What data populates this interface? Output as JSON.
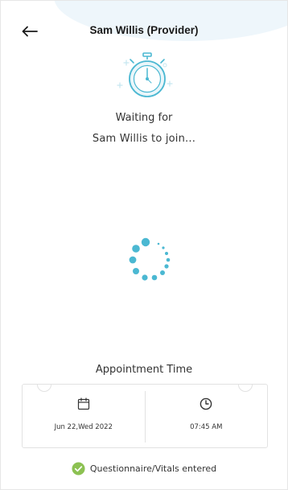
{
  "header": {
    "title": "Sam Willis (Provider)",
    "back_icon": "arrow-left-icon"
  },
  "waiting": {
    "line1": "Waiting for",
    "line2": "Sam Willis to join...",
    "icon": "stopwatch-icon"
  },
  "loader": {
    "icon": "loading-spinner"
  },
  "appointment": {
    "title": "Appointment Time",
    "date": "Jun 22,Wed 2022",
    "time": "07:45 AM",
    "date_icon": "calendar-icon",
    "time_icon": "clock-icon"
  },
  "status": {
    "text": "Questionnaire/Vitals entered",
    "icon": "check-circle-icon"
  },
  "colors": {
    "accent": "#4bb8d2",
    "success": "#8cc152",
    "text": "#333333",
    "background_wave": "#eef6fb"
  }
}
